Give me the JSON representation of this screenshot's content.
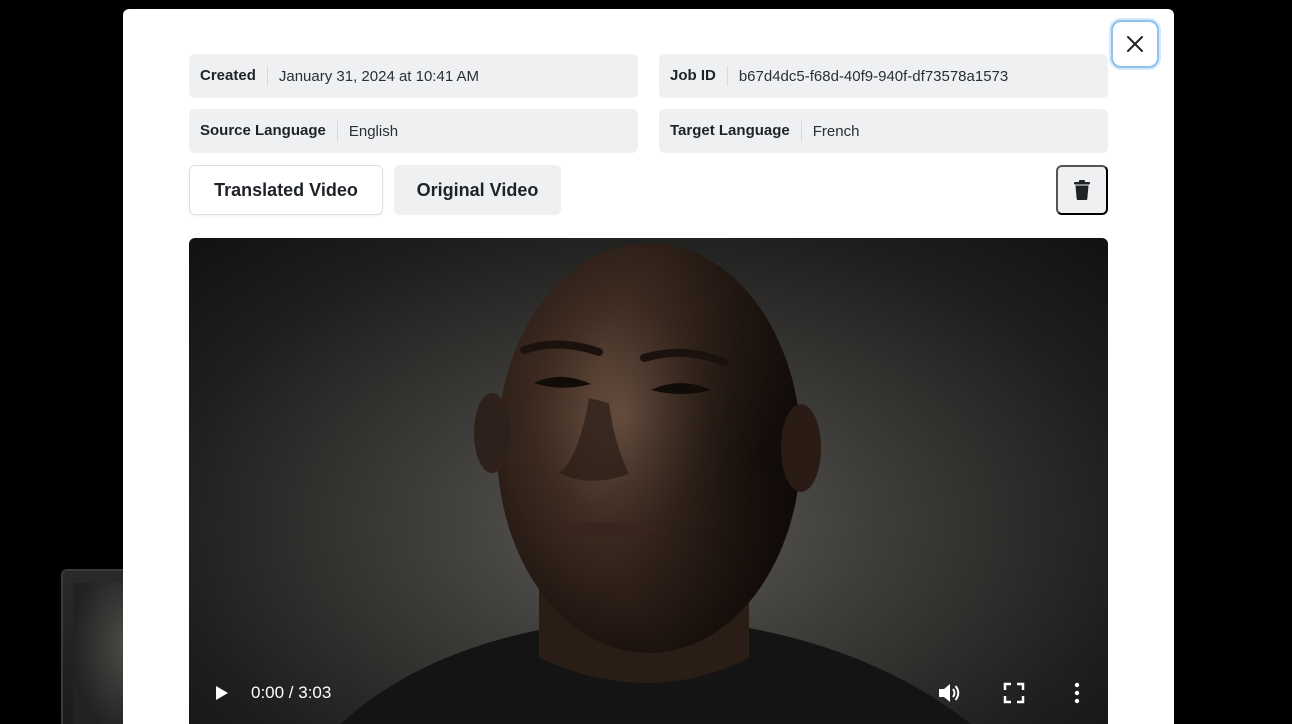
{
  "details": {
    "created_label": "Created",
    "created_value": "January 31, 2024 at 10:41 AM",
    "job_id_label": "Job ID",
    "job_id_value": "b67d4dc5-f68d-40f9-940f-df73578a1573",
    "source_language_label": "Source Language",
    "source_language_value": "English",
    "target_language_label": "Target Language",
    "target_language_value": "French"
  },
  "tabs": [
    {
      "label": "Translated Video",
      "active": true
    },
    {
      "label": "Original Video",
      "active": false
    }
  ],
  "player": {
    "time_display": "0:00 / 3:03",
    "play_icon": "play-icon",
    "volume_icon": "volume-icon",
    "fullscreen_icon": "fullscreen-icon",
    "more_icon": "more-vertical-icon"
  },
  "icons": {
    "close": "close-icon",
    "delete": "trash-icon"
  },
  "colors": {
    "backdrop": "#000000",
    "modal": "#ffffff",
    "info_bg": "#eef0f2",
    "close_focus_ring": "#8ec2f0"
  }
}
